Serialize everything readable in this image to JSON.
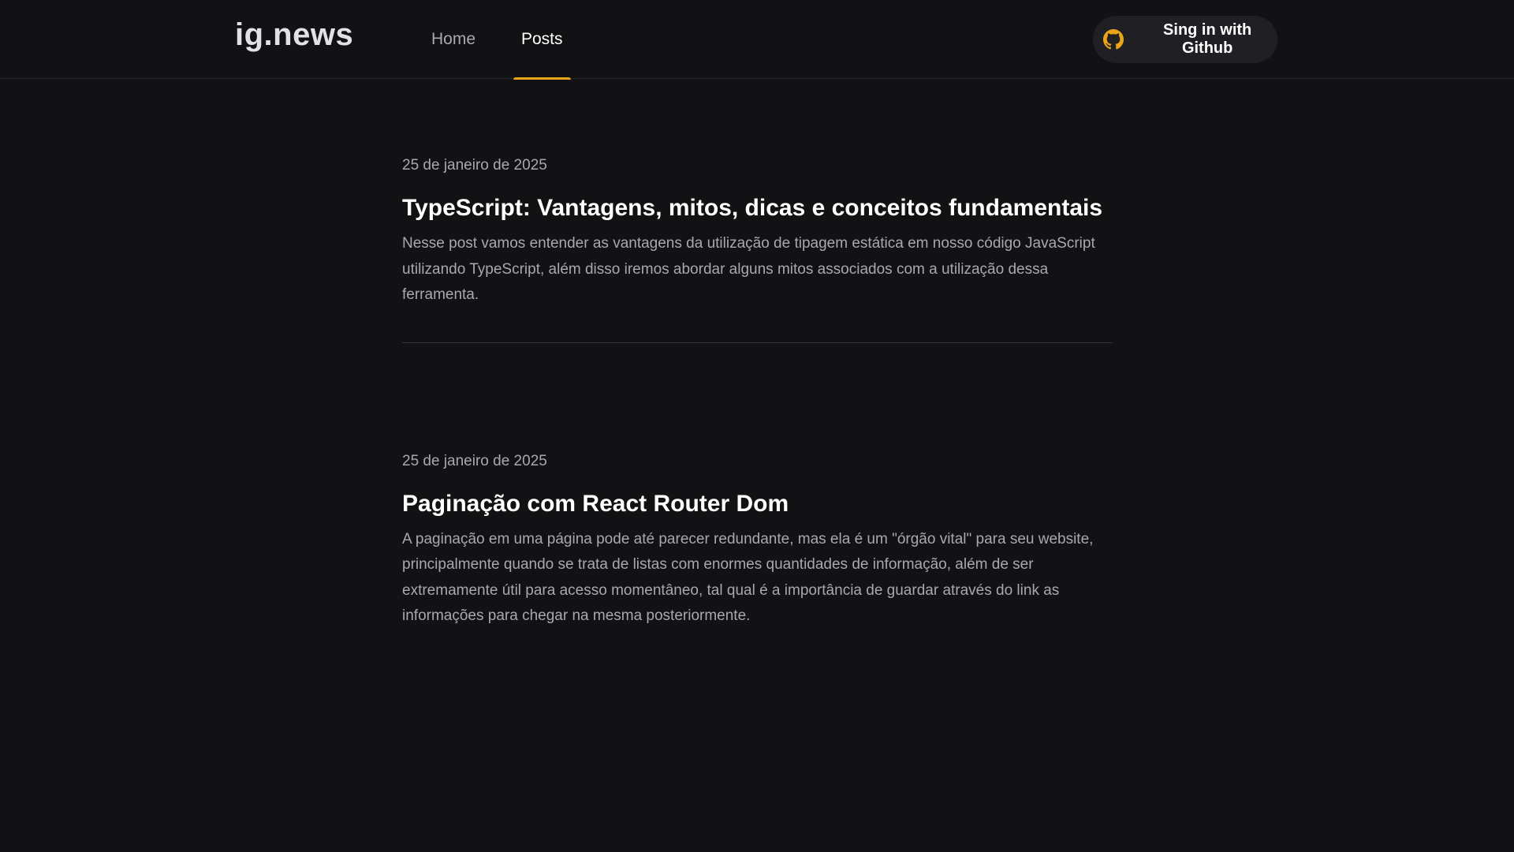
{
  "header": {
    "logo": "ig.news",
    "nav": [
      {
        "label": "Home",
        "active": false
      },
      {
        "label": "Posts",
        "active": true
      }
    ],
    "signin_label": "Sing in with Github",
    "signin_icon": "github-icon",
    "accent_color": "#eba417"
  },
  "posts": [
    {
      "date": "25 de janeiro de 2025",
      "title": "TypeScript: Vantagens, mitos, dicas e conceitos fundamentais",
      "excerpt": "Nesse post vamos entender as vantagens da utilização de tipagem estática em nosso código JavaScript utilizando TypeScript, além disso iremos abordar alguns mitos associados com a utilização dessa ferramenta."
    },
    {
      "date": "25 de janeiro de 2025",
      "title": "Paginação com React Router Dom",
      "excerpt": "A paginação em uma página pode até parecer redundante, mas ela é um \"órgão vital\" para seu website, principalmente quando se trata de listas com enormes quantidades de informação, além de ser extremamente útil para acesso momentâneo, tal qual é a importância de guardar através do link as informações para chegar na mesma posteriormente."
    }
  ]
}
